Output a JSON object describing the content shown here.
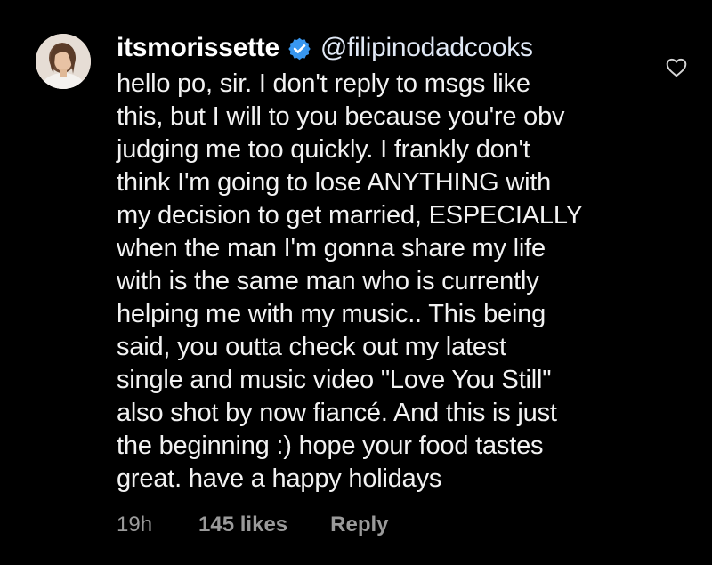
{
  "comment": {
    "username": "itsmorissette",
    "verified_icon": "verified-badge-icon",
    "mention": "@filipinodadcooks",
    "lines": [
      "hello po, sir. I don't reply to msgs like",
      "this, but I will to you because you're obv",
      "judging me too quickly. I frankly don't",
      "think I'm going to lose ANYTHING with",
      "my decision to get married, ESPECIALLY",
      "when the man I'm gonna share my life",
      "with is the same man who is currently",
      "helping me with my music.. This being",
      "said, you outta check out my latest",
      "single and music video \"Love You Still\"",
      "also shot by now fiancé. And this is just",
      "the beginning :) hope your food tastes",
      "great. have a happy holidays"
    ],
    "time": "19h",
    "likes": "145 likes",
    "reply_label": "Reply",
    "like_icon": "heart-icon"
  },
  "colors": {
    "background": "#000000",
    "text": "#ffffff",
    "meta": "#9a9a9a",
    "verified": "#3897f0"
  }
}
